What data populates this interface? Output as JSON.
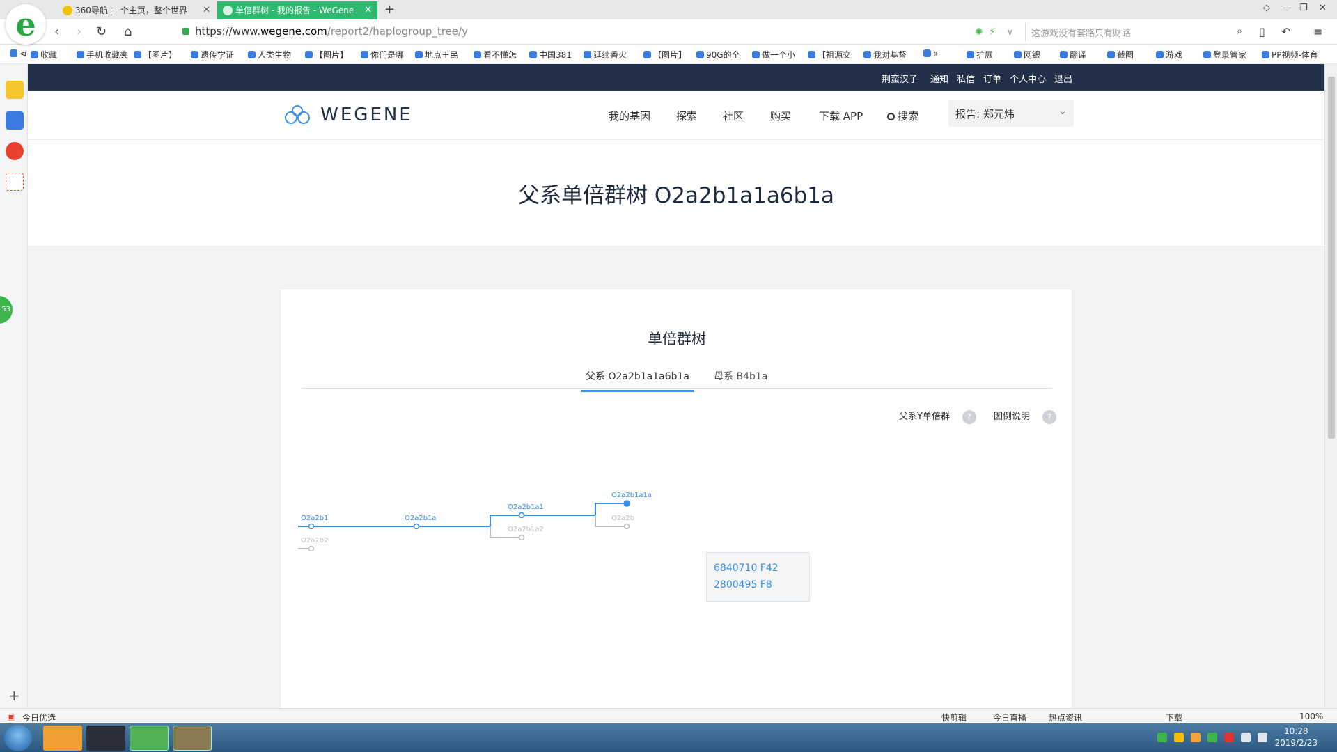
{
  "browser": {
    "logo_letter": "e",
    "tabs": [
      {
        "title": "360导航_一个主页，整个世界",
        "active": false
      },
      {
        "title": "单倍群树 - 我的报告 - WeGene",
        "active": true
      }
    ],
    "new_tab": "+",
    "url_prefix": "https://www.",
    "url_domain": "wegene.com",
    "url_path": "/report2/haplogroup_tree/y",
    "search_placeholder": "这游戏没有套路只有财路",
    "bookmarks": [
      "收藏",
      "手机收藏夹",
      "【图片】",
      "遗传学证",
      "人类生物",
      "【图片】",
      "你们是哪",
      "地点＋民",
      "看不懂怎",
      "中国381",
      "延续香火",
      "【图片】",
      "90G的全",
      "做一个小",
      "【祖源交",
      "我对基督",
      "»",
      "扩展",
      "网银",
      "翻译",
      "截图",
      "游戏",
      "登录管家",
      "PP视频-体育"
    ]
  },
  "site": {
    "top_links": [
      "荆蛮汉子",
      "通知",
      "私信",
      "订单",
      "个人中心",
      "退出"
    ],
    "logo_text": "WEGENE",
    "nav": [
      "我的基因",
      "探索",
      "社区",
      "购买",
      "下载 APP"
    ],
    "search_label": "搜索",
    "report_select": "报告: 郑元炜",
    "page_title": "父系单倍群树 O2a2b1a1a6b1a"
  },
  "card": {
    "title": "单倍群树",
    "tabs": [
      "父系 O2a2b1a1a6b1a",
      "母系 B4b1a"
    ],
    "help_links": [
      "父系Y单倍群",
      "图例说明"
    ],
    "help_icon": "?"
  },
  "tree": {
    "nodes": [
      {
        "label": "O2a2b1",
        "state": "active"
      },
      {
        "label": "O2a2b2",
        "state": "inactive"
      },
      {
        "label": "O2a2b1a",
        "state": "active"
      },
      {
        "label": "O2a2b1a1",
        "state": "active"
      },
      {
        "label": "O2a2b1a2",
        "state": "inactive"
      },
      {
        "label": "O2a2b1a1a",
        "state": "selected"
      },
      {
        "label": "O2a2b",
        "state": "inactive"
      }
    ],
    "tooltip_lines": [
      "6840710 F42",
      "2800495 F8"
    ],
    "colors": {
      "active": "#3a8ee6",
      "inactive": "#b9bec5"
    }
  },
  "statusbar": {
    "left": "今日优选",
    "right": [
      "快剪辑",
      "今日直播",
      "热点资讯",
      "下载",
      "100%"
    ]
  },
  "taskbar": {
    "time": "10:28",
    "date": "2019/2/23"
  },
  "icons": [
    "browser-logo-icon",
    "back-icon",
    "forward-icon",
    "reload-icon",
    "home-icon",
    "lock-icon",
    "search-icon",
    "star-icon",
    "chevron-down-icon",
    "help-icon",
    "start-icon"
  ]
}
